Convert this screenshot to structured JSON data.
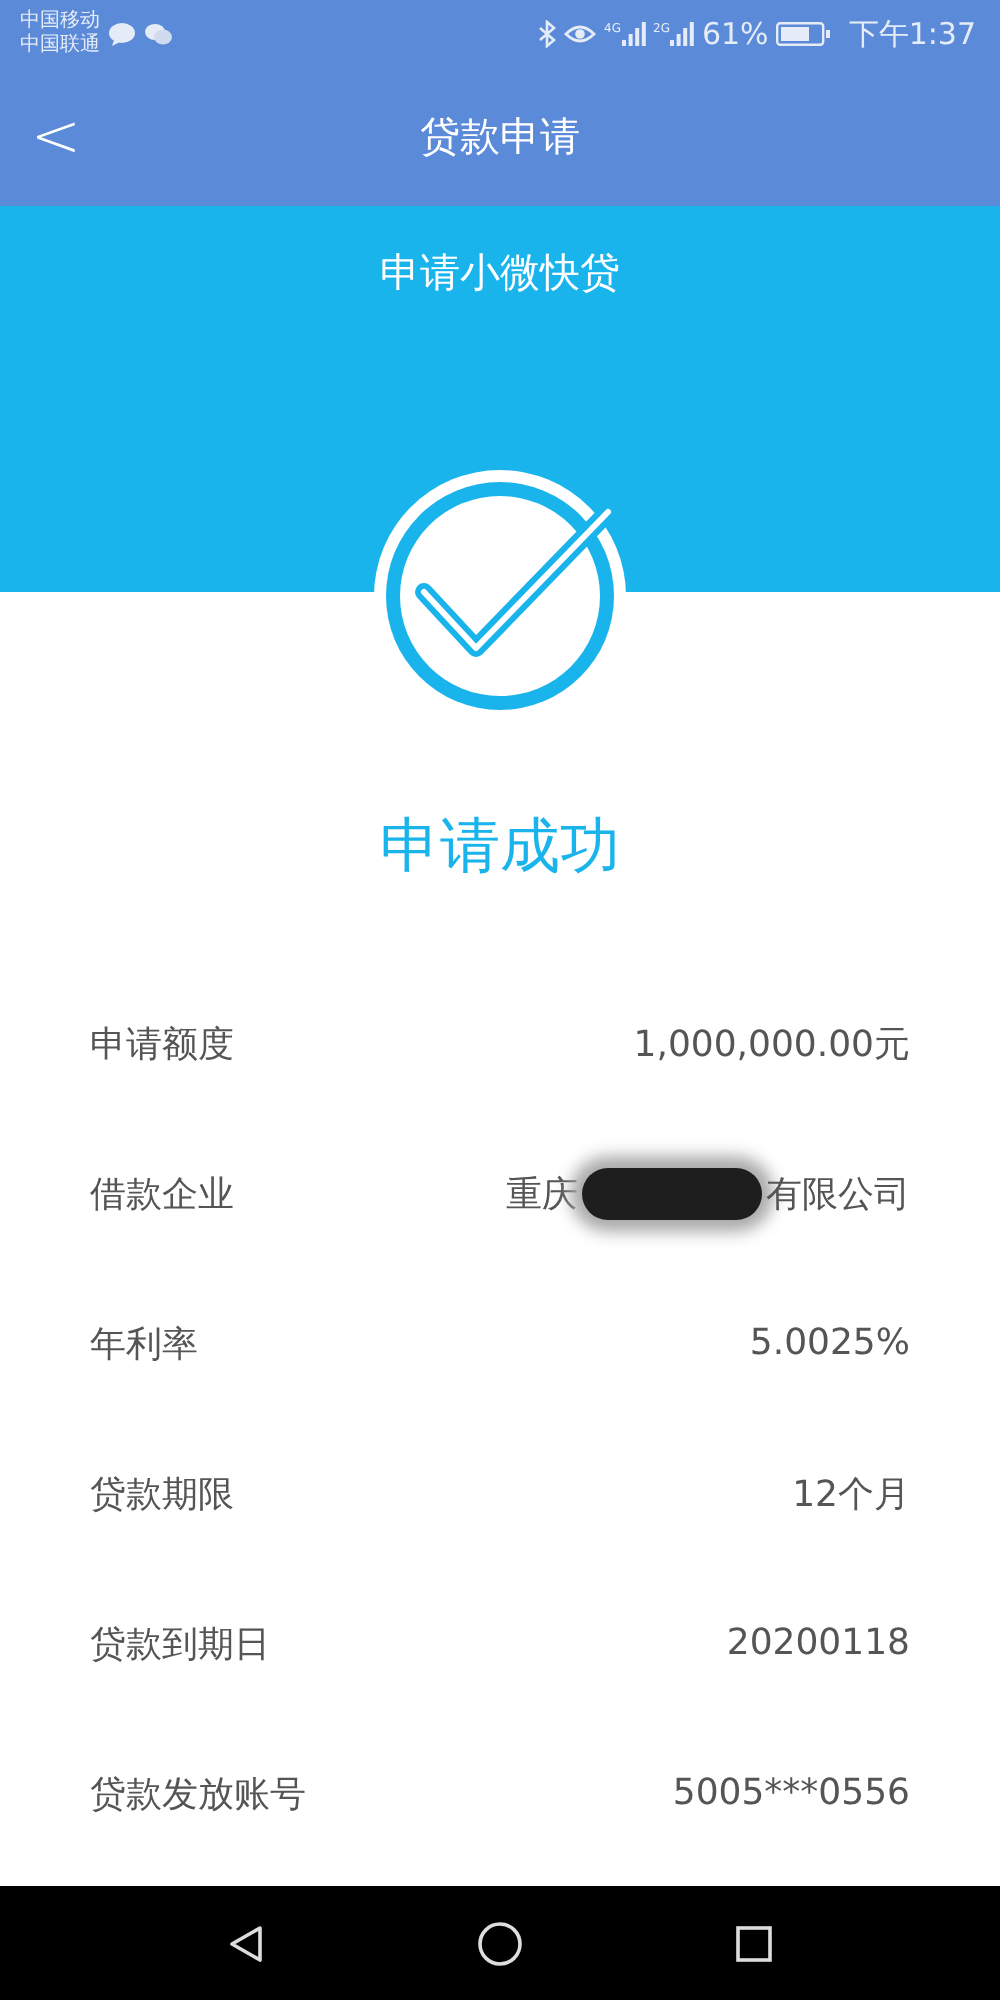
{
  "status_bar": {
    "carriers": [
      "中国移动",
      "中国联通"
    ],
    "networks": [
      "4G",
      "2G"
    ],
    "battery": "61%",
    "time": "下午1:37"
  },
  "nav_bar": {
    "back": "<",
    "title": "贷款申请"
  },
  "banner": {
    "subtitle": "申请小微快贷"
  },
  "result": {
    "kind": "success",
    "message": "申请成功"
  },
  "details": [
    {
      "label": "申请额度",
      "value": "1,000,000.00元"
    },
    {
      "label": "借款企业",
      "value": "重庆",
      "value_end": "有限公司",
      "redacted": true
    },
    {
      "label": "年利率",
      "value": "5.0025%"
    },
    {
      "label": "贷款期限",
      "value": "12个月"
    },
    {
      "label": "贷款到期日",
      "value": "20200118"
    },
    {
      "label": "贷款发放账号",
      "value": "5005***0556"
    }
  ]
}
